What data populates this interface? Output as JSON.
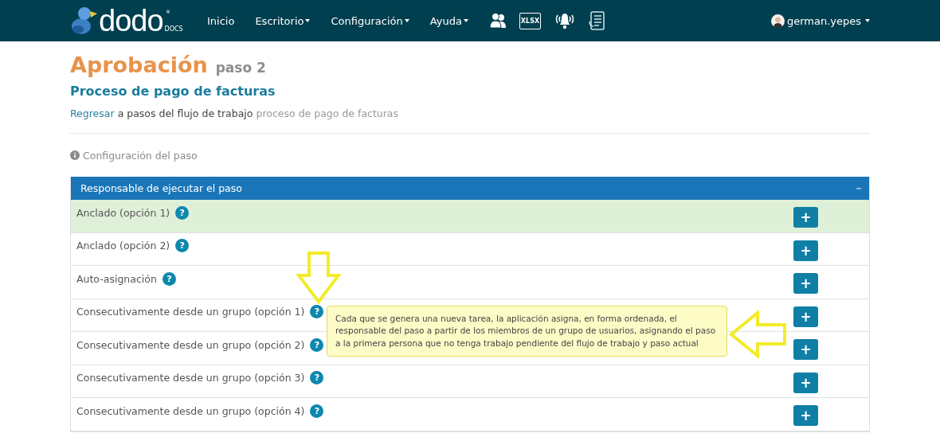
{
  "navbar": {
    "logo": {
      "name": "dodo",
      "mark": "®",
      "sub": "DOCS"
    },
    "menu": [
      {
        "label": "Inicio",
        "dropdown": false
      },
      {
        "label": "Escritorio",
        "dropdown": true
      },
      {
        "label": "Configuración",
        "dropdown": true
      },
      {
        "label": "Ayuda",
        "dropdown": true
      }
    ],
    "icons": [
      {
        "kind": "users"
      },
      {
        "kind": "xlsx",
        "label": "XLSX"
      },
      {
        "kind": "bell"
      },
      {
        "kind": "document"
      }
    ],
    "user": {
      "name": "german.yepes"
    }
  },
  "header": {
    "title": "Aprobación",
    "step": "paso 2",
    "subtitle": "Proceso de pago de facturas",
    "breadcrumb": {
      "link": "Regresar",
      "text": "a pasos del flujo de trabajo",
      "workflow": "proceso de pago de facturas"
    }
  },
  "section_label": "Configuración del paso",
  "panel": {
    "title": "Responsable de ejecutar el paso",
    "rows": [
      {
        "label": "Anclado (opción 1)",
        "help": "?",
        "add": "+",
        "selected": true
      },
      {
        "label": "Anclado (opción 2)",
        "help": "?",
        "add": "+",
        "selected": false
      },
      {
        "label": "Auto-asignación",
        "help": "?",
        "add": "+",
        "selected": false
      },
      {
        "label": "Consecutivamente desde un grupo (opción 1)",
        "help": "?",
        "add": "+",
        "selected": false,
        "tooltip": "Cada que se genera una nueva tarea, la aplicación asigna, en forma ordenada, el responsable del paso a partir de los miembros de un grupo de usuarios, asignando el paso a la primera persona que no tenga trabajo pendiente del flujo de trabajo y paso actual"
      },
      {
        "label": "Consecutivamente desde un grupo (opción 2)",
        "help": "?",
        "add": "+",
        "selected": false
      },
      {
        "label": "Consecutivamente desde un grupo (opción 3)",
        "help": "?",
        "add": "+",
        "selected": false
      },
      {
        "label": "Consecutivamente desde un grupo (opción 4)",
        "help": "?",
        "add": "+",
        "selected": false
      }
    ]
  }
}
